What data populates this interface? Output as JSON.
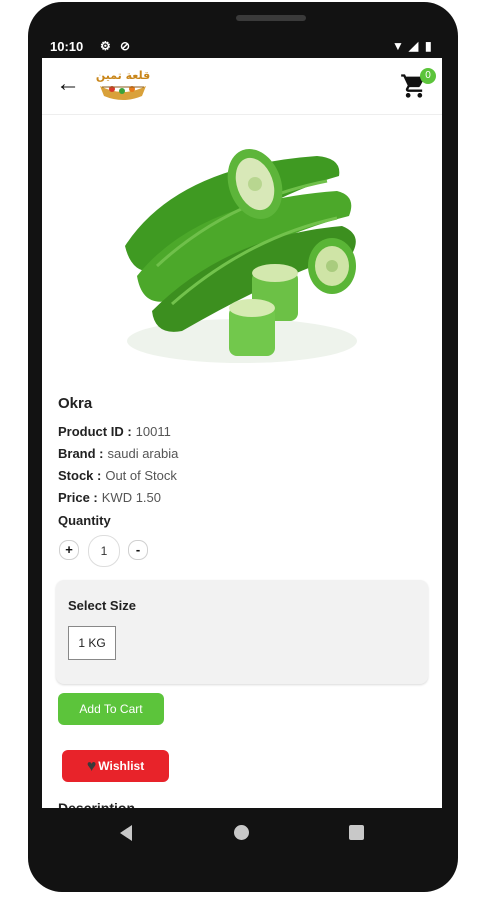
{
  "status_bar": {
    "time": "10:10"
  },
  "app_bar": {
    "back_icon": "arrow-left-icon",
    "logo_text": "قلعة تمين",
    "cart_count": "0"
  },
  "product": {
    "title": "Okra",
    "image": "okra-image",
    "details": [
      {
        "label": "Product ID :",
        "value": "10011"
      },
      {
        "label": "Brand :",
        "value": "saudi arabia"
      },
      {
        "label": "Stock :",
        "value": "Out of Stock"
      },
      {
        "label": "Price :",
        "value": "KWD 1.50"
      }
    ]
  },
  "quantity": {
    "label": "Quantity",
    "plus": "+",
    "value": "1",
    "minus": "-"
  },
  "size": {
    "title": "Select Size",
    "options": [
      "1 KG"
    ]
  },
  "buttons": {
    "add_to_cart": "Add To Cart",
    "wishlist": "Wishlist"
  },
  "description_label": "Description",
  "colors": {
    "accent_green": "#5cc43b",
    "wishlist_red": "#e8232a"
  }
}
